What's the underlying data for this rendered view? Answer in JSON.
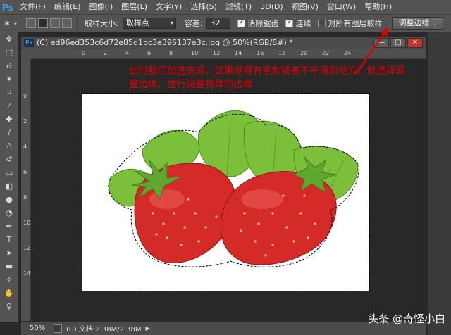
{
  "app": {
    "logo": "Ps"
  },
  "menu": [
    "文件(F)",
    "编辑(E)",
    "图像(I)",
    "图层(L)",
    "文字(Y)",
    "选择(S)",
    "滤镜(T)",
    "3D(D)",
    "视图(V)",
    "窗口(W)",
    "帮助(H)"
  ],
  "options": {
    "sample_size_label": "取样大小:",
    "sample_size_value": "取样点",
    "tolerance_label": "容差:",
    "tolerance_value": "32",
    "antialias_label": "消除锯齿",
    "contiguous_label": "连续",
    "all_layers_label": "对所有图层取样",
    "refine_edge_label": "调整边缘..."
  },
  "document": {
    "title": "(C) ed96ed353c6d72e85d1bc3e396137e3c.jpg @ 50%(RGB/8#) *",
    "ruler_top": [
      "0",
      "2",
      "4",
      "6",
      "8",
      "10",
      "12",
      "14",
      "16",
      "18",
      "20",
      "22",
      "24"
    ],
    "ruler_left": [
      "0",
      "2",
      "4",
      "6",
      "8",
      "10",
      "12",
      "14"
    ]
  },
  "annotation": {
    "line1": "此时我们加选完成，如果觉得有毛刺或者不平滑的地方，就选择调",
    "line2": "整边缘。进行调整物体的边缘"
  },
  "status": {
    "zoom": "50%",
    "doc_info": "(C) 文档:2.38M/2.38M"
  },
  "watermark": "头条 @奇怪小白",
  "colors": {
    "annotation": "#e00000",
    "strawberry": "#d42a28",
    "leaf": "#7cbf3a"
  }
}
